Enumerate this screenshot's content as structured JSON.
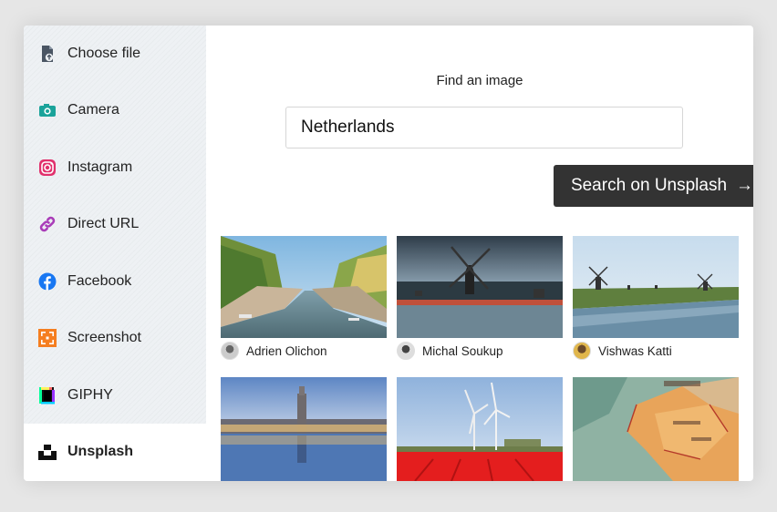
{
  "sidebar": {
    "items": [
      {
        "label": "Choose file",
        "icon": "file-upload-icon"
      },
      {
        "label": "Camera",
        "icon": "camera-icon"
      },
      {
        "label": "Instagram",
        "icon": "instagram-icon"
      },
      {
        "label": "Direct URL",
        "icon": "link-icon"
      },
      {
        "label": "Facebook",
        "icon": "facebook-icon"
      },
      {
        "label": "Screenshot",
        "icon": "screenshot-icon"
      },
      {
        "label": "GIPHY",
        "icon": "giphy-icon"
      },
      {
        "label": "Unsplash",
        "icon": "unsplash-icon",
        "active": true
      }
    ]
  },
  "search": {
    "title": "Find an image",
    "value": "Netherlands",
    "button_label": "Search on Unsplash",
    "button_arrow": "→"
  },
  "results": [
    {
      "author": "Adrien Olichon"
    },
    {
      "author": "Michal Soukup"
    },
    {
      "author": "Vishwas Katti"
    },
    {
      "author": ""
    },
    {
      "author": ""
    },
    {
      "author": ""
    }
  ],
  "colors": {
    "button_bg": "#333333",
    "camera": "#1aa39a",
    "instagram": "#e1306c",
    "link": "#a93cb8",
    "facebook": "#1877f2",
    "screenshot": "#f57e20"
  }
}
